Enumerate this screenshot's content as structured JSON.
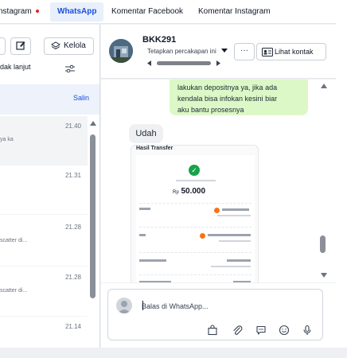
{
  "tabs": [
    {
      "label": "nstagram",
      "has_dot": true
    },
    {
      "label": "WhatsApp",
      "active": true
    },
    {
      "label": "Komentar Facebook"
    },
    {
      "label": "Komentar Instagram"
    }
  ],
  "left_panel": {
    "manage_label": "Kelola",
    "filter_label": "dak lanjut",
    "copy_label": "Salin",
    "conversations": [
      {
        "time": "21.40",
        "snippet": "ya ka",
        "selected": true
      },
      {
        "time": "21.31",
        "snippet": ""
      },
      {
        "time": "21.28",
        "snippet": "scatter di..."
      },
      {
        "time": "21.28",
        "snippet": "scatter di..."
      },
      {
        "time": "21.14",
        "snippet": ""
      }
    ]
  },
  "chat_header": {
    "contact_name": "BKK291",
    "assign_label": "Tetapkan percakapan ini",
    "more_label": "···",
    "view_contact_label": "Lihat kontak"
  },
  "messages": {
    "outgoing_text_1": "lakukan depositnya ya, jika ada",
    "outgoing_text_2": "kendala bisa infokan kesini biar",
    "outgoing_text_3": "aku bantu prosesnya",
    "incoming_text": "Udah",
    "receipt": {
      "title": "Hasil Transfer",
      "currency": "Rp",
      "amount": "50.000"
    }
  },
  "composer": {
    "placeholder": "Balas di WhatsApp..."
  },
  "colors": {
    "accent": "#1d4ed8",
    "outgoing_bubble": "#dcf8c6",
    "success": "#16a34a"
  }
}
